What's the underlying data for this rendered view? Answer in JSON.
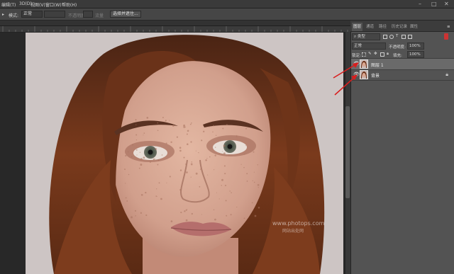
{
  "menubar": {
    "items": [
      "编辑(T)",
      "3D(D)",
      "视图(V)",
      "窗口(W)",
      "帮助(H)"
    ],
    "window_controls": [
      "–",
      "□",
      "✕"
    ]
  },
  "options_bar": {
    "mode_label": "模式:",
    "mode_value": "正常",
    "opacity_label": "不透明度",
    "flow_label": "流量",
    "select_mask_button": "选择并遮住..."
  },
  "canvas": {
    "watermark_line1": "www.photops.com",
    "watermark_line2": "网站出处网"
  },
  "layers_panel": {
    "tabs": [
      "图层",
      "通道",
      "路径",
      "历史记录",
      "属性"
    ],
    "filter_kind": "类型",
    "blend_mode": "正常",
    "opacity_label": "不透明度:",
    "opacity_value": "100%",
    "lock_label": "锁定:",
    "fill_label": "填充:",
    "fill_value": "100%",
    "layers": [
      {
        "name": "图层 1",
        "selected": true,
        "locked": false
      },
      {
        "name": "背景",
        "selected": false,
        "locked": true
      }
    ]
  },
  "annotations": {
    "arrow_color": "#d91e1e"
  }
}
